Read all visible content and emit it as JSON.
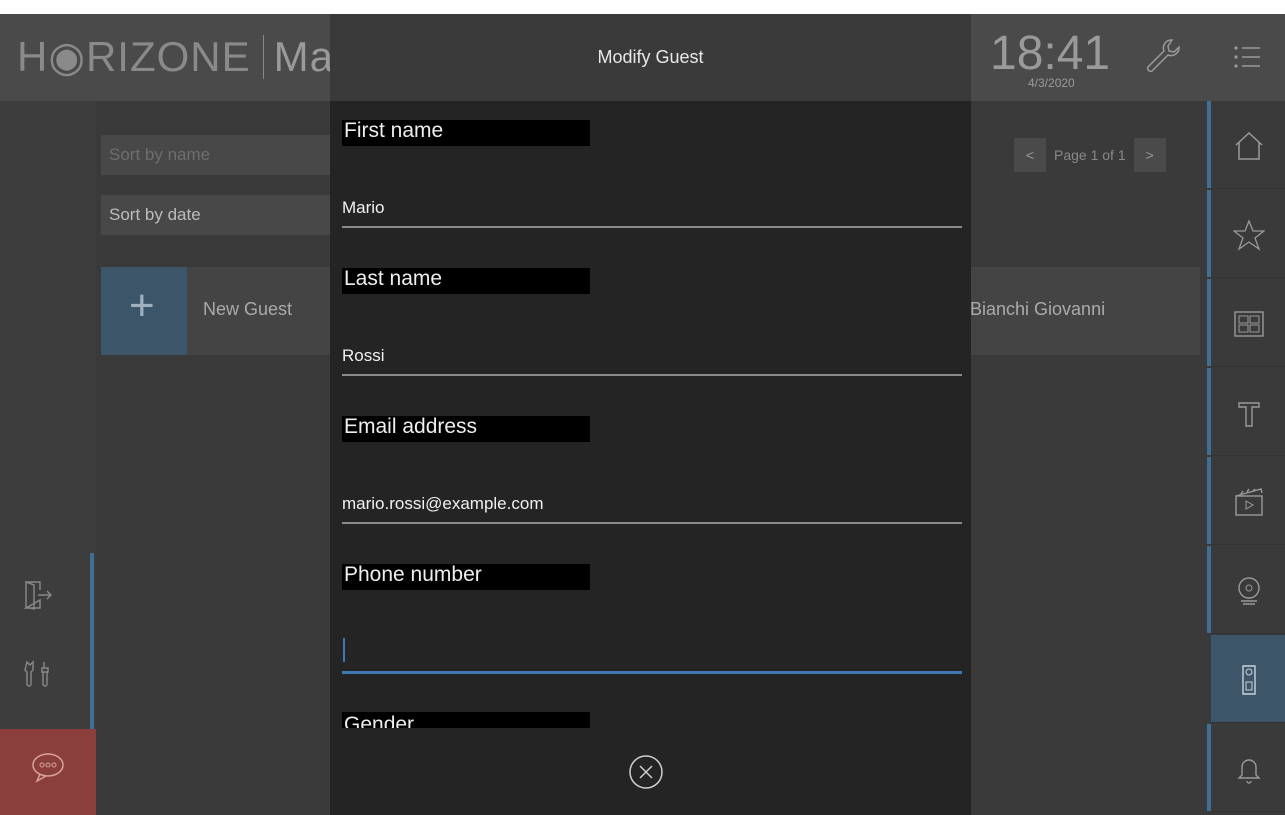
{
  "app": {
    "brand": "H◉RIZONE",
    "section": "Main",
    "time": "18:41",
    "date": "4/3/2020"
  },
  "list": {
    "sort_name": "Sort by name",
    "sort_date": "Sort by date",
    "new_guest": "New Guest",
    "guest_name": "Bianchi Giovanni",
    "page_prev": "<",
    "page_label": "Page 1 of 1",
    "page_next": ">"
  },
  "modal": {
    "title": "Modify Guest",
    "fields": [
      {
        "label": "First name",
        "value": "Mario"
      },
      {
        "label": "Last name",
        "value": "Rossi"
      },
      {
        "label": "Email address",
        "value": "mario.rossi@example.com"
      },
      {
        "label": "Phone number",
        "value": ""
      },
      {
        "label": "Gender",
        "value": ""
      }
    ]
  },
  "sidebar": {
    "items": [
      "home-icon",
      "star-icon",
      "dashboard-icon",
      "hammer-icon",
      "scenario-icon",
      "camera-icon",
      "door-hanger-icon",
      "bell-icon"
    ],
    "active_item": "door-hanger-icon"
  },
  "colors": {
    "accent": "#3f6f94",
    "active_bg": "#3d5568",
    "chat_bg": "#8a3f3c",
    "modal_bg": "#242424"
  }
}
